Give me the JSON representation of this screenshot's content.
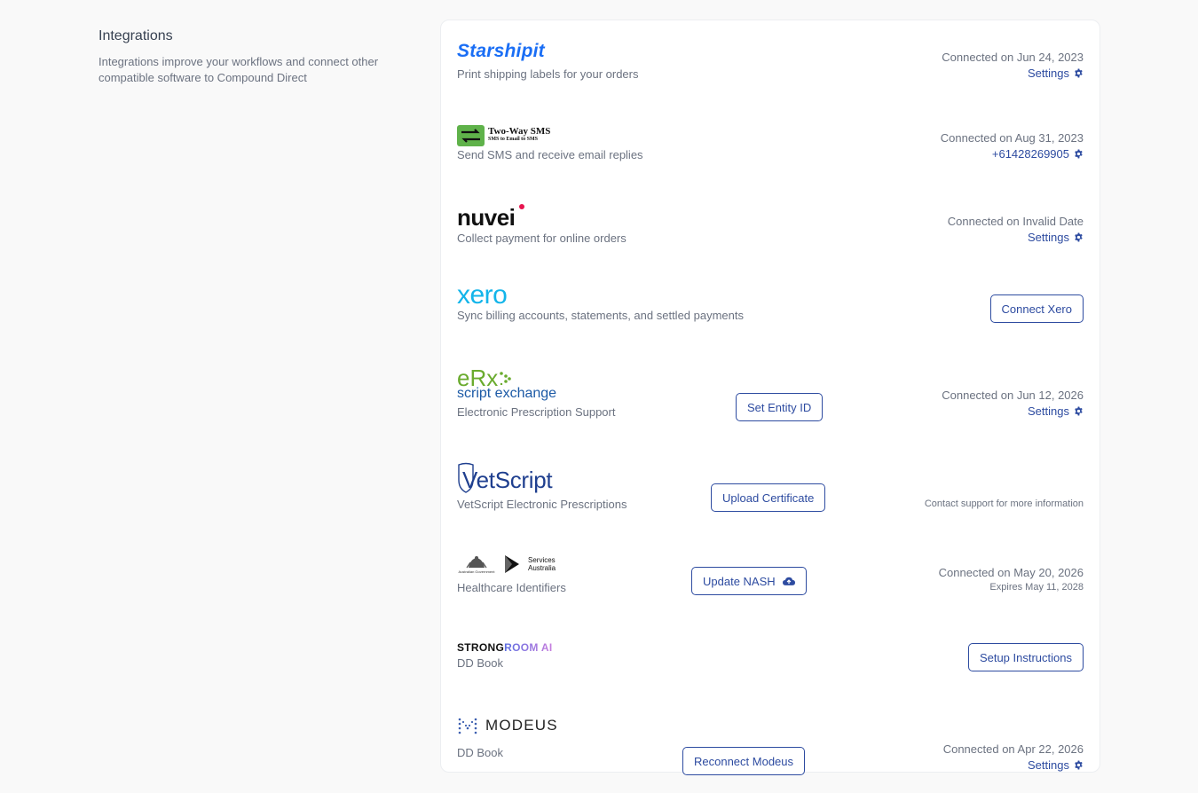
{
  "intro": {
    "title": "Integrations",
    "description": "Integrations improve your workflows and connect other compatible software to Compound Direct"
  },
  "integrations": [
    {
      "logo_text": "Starshipit",
      "description": "Print shipping labels for your orders",
      "status": "Connected on Jun 24, 2023",
      "link": "Settings"
    },
    {
      "logo_text": "Two-Way SMS",
      "logo_subtext": "SMS to Email to SMS",
      "description": "Send SMS and receive email replies",
      "status": "Connected on Aug 31, 2023",
      "link": "+61428269905"
    },
    {
      "logo_text": "nuvei",
      "description": "Collect payment for online orders",
      "status": "Connected on Invalid Date",
      "link": "Settings"
    },
    {
      "logo_text": "xero",
      "description": "Sync billing accounts, statements, and settled payments",
      "button": "Connect Xero"
    },
    {
      "logo_text": "eRx",
      "logo_subtext": "script exchange",
      "description": "Electronic Prescription Support",
      "button": "Set Entity ID",
      "status": "Connected on Jun 12, 2026",
      "link": "Settings"
    },
    {
      "logo_text": "VetScript",
      "description": "VetScript Electronic Prescriptions",
      "button": "Upload Certificate",
      "note": "Contact support for more information"
    },
    {
      "logo_text": "Services Australia",
      "logo_subtext": "Australian Government",
      "description": "Healthcare Identifiers",
      "button": "Update NASH",
      "status": "Connected on May 20, 2026",
      "note": "Expires May 11, 2028"
    },
    {
      "logo_text": "STRONG",
      "logo_text2": "ROOM AI",
      "description": "DD Book",
      "button": "Setup Instructions"
    },
    {
      "logo_text": "MODEUS",
      "description": "DD Book",
      "button": "Reconnect Modeus",
      "status": "Connected on Apr 22, 2026",
      "link": "Settings"
    }
  ],
  "colors": {
    "link": "#2d4ba0",
    "starshipit": "#1a6ef5",
    "xero": "#13b5ea",
    "erx_green": "#6aab2e",
    "erx_blue": "#1c5aa6",
    "vetscript": "#1f3f8f",
    "strongroom_gradient_start": "#5b6ee1",
    "strongroom_gradient_end": "#c77dde"
  }
}
